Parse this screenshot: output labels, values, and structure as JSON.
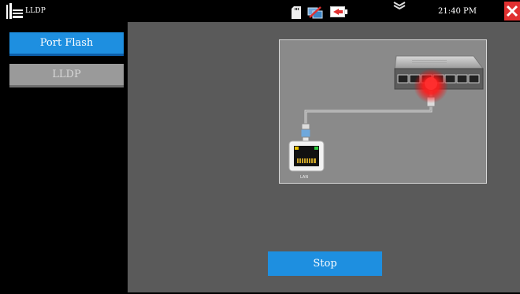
{
  "window": {
    "title": "LLDP",
    "clock": "21:40 PM"
  },
  "status_icons": [
    "sd-card-icon",
    "network-disconnected-icon",
    "battery-low-icon",
    "signal-icon"
  ],
  "sidebar": {
    "items": [
      {
        "label": "Port Flash",
        "active": true
      },
      {
        "label": "LLDP",
        "active": false
      }
    ]
  },
  "diagram": {
    "lan_label": "LAN"
  },
  "actions": {
    "stop_label": "Stop"
  },
  "colors": {
    "accent": "#1e8fe0",
    "inactive": "#9a9a9a",
    "background": "#5a5a5a",
    "flash": "#ff1a1a",
    "close": "#e03030"
  }
}
